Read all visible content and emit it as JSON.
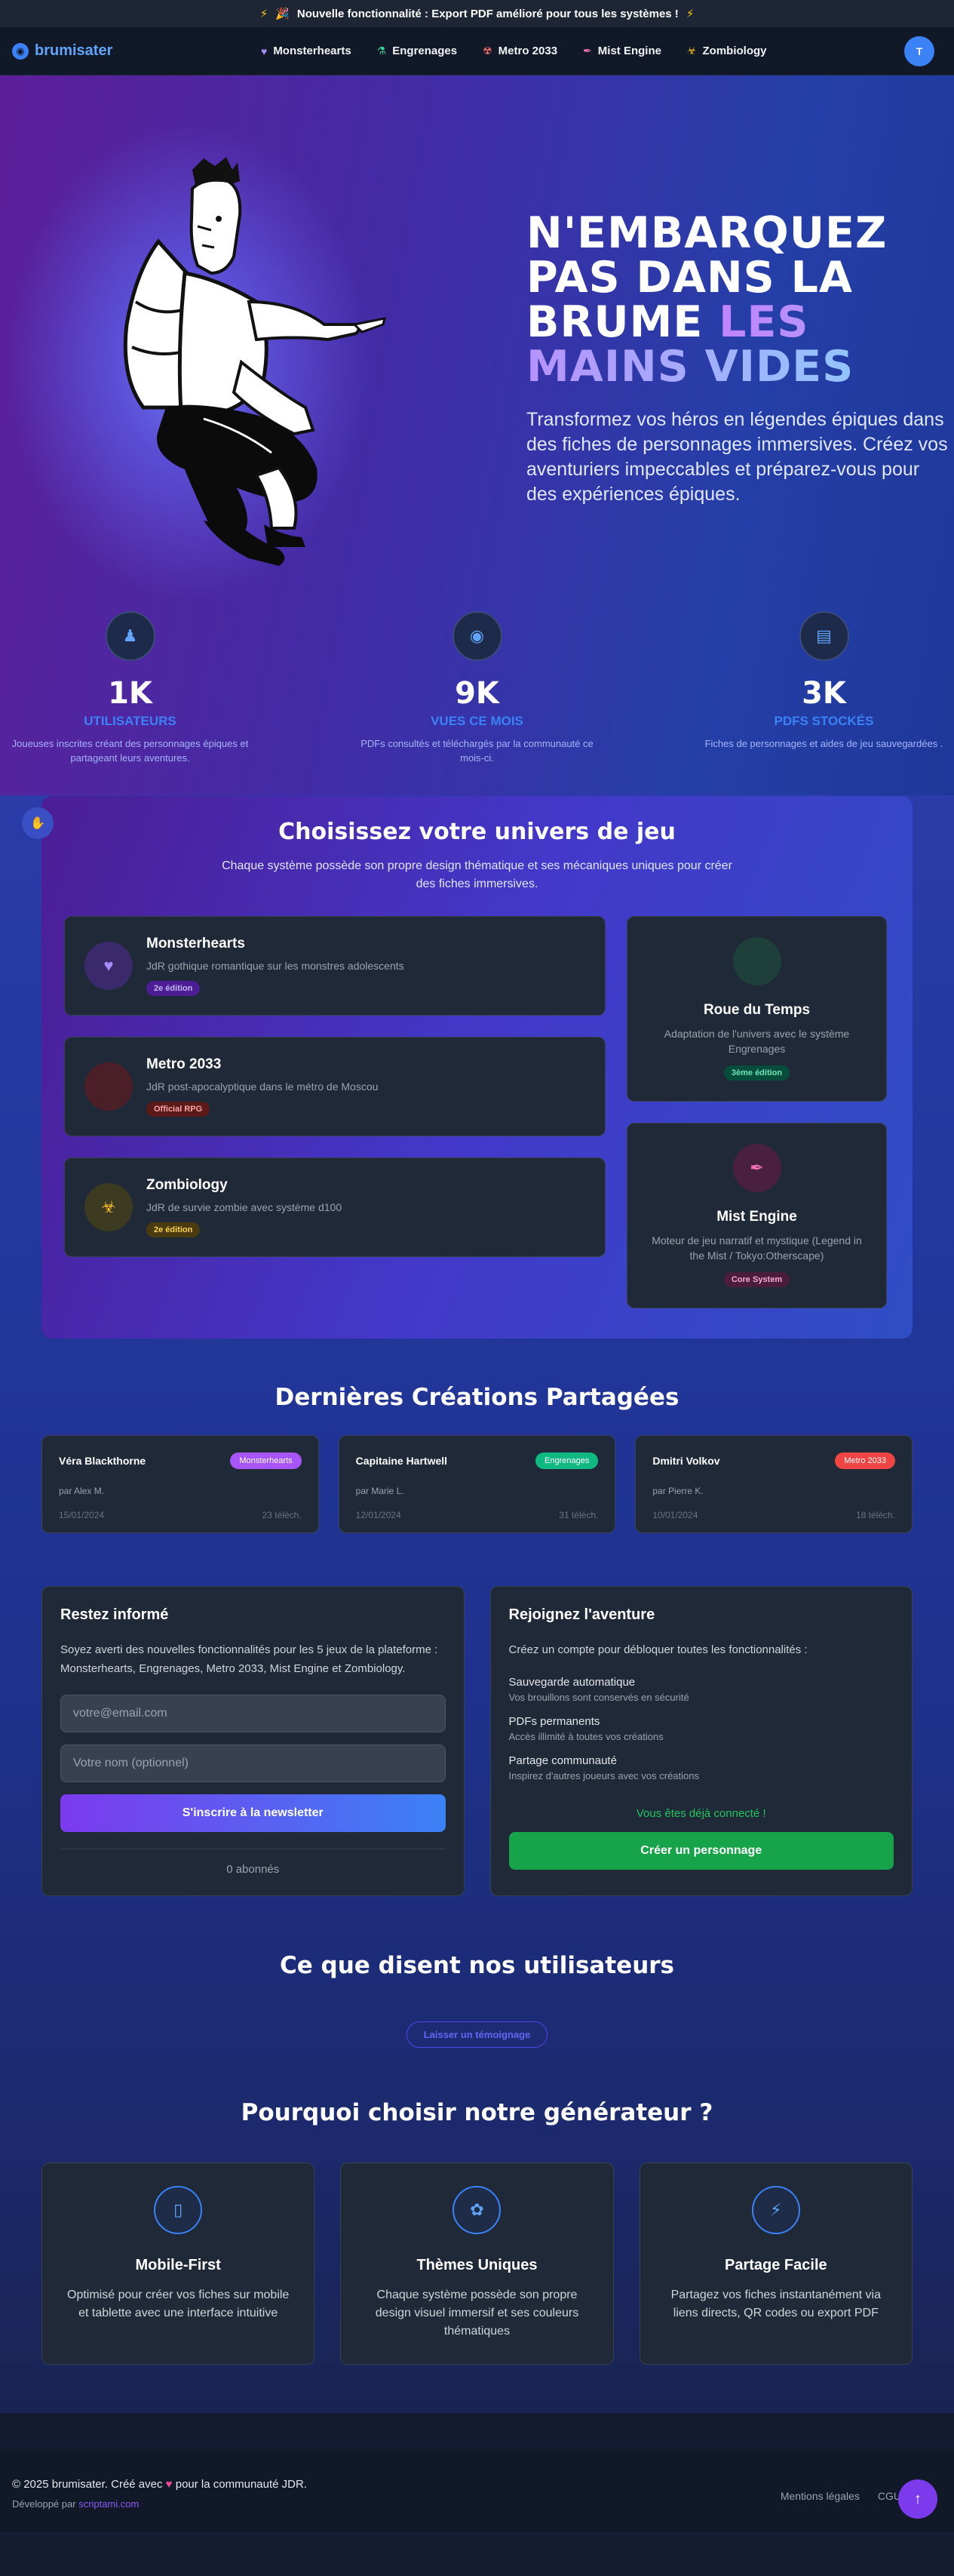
{
  "banner": {
    "text": "Nouvelle fonctionnalité : Export PDF amélioré pour tous les systèmes !",
    "left_icon": "zap-icon",
    "flag_icon": "party-icon"
  },
  "nav": {
    "brand": "brumisater",
    "links": [
      {
        "label": "Monsterhearts",
        "icon": "heart-icon",
        "color": "#a78bfa"
      },
      {
        "label": "Engrenages",
        "icon": "flask-icon",
        "color": "#34d399"
      },
      {
        "label": "Metro 2033",
        "icon": "radiation-icon",
        "color": "#f87171"
      },
      {
        "label": "Mist Engine",
        "icon": "feather-icon",
        "color": "#f472b6"
      },
      {
        "label": "Zombiology",
        "icon": "biohazard-icon",
        "color": "#fbbf24"
      }
    ],
    "avatar": "T"
  },
  "hero": {
    "title_white": "N'EMBARQUEZ PAS DANS LA BRUME",
    "title_accent": "LES MAINS VIDES",
    "subtitle": "Transformez vos héros en légendes épiques dans des fiches de personnages immersives. Créez vos aventuriers impeccables et préparez-vous pour des expériences épiques."
  },
  "stats": [
    {
      "value": "1K",
      "label": "UTILISATEURS",
      "desc": "Joueuses inscrites créant des personnages épiques et partageant leurs aventures.",
      "icon": "user-icon"
    },
    {
      "value": "9K",
      "label": "VUES CE MOIS",
      "desc": "PDFs consultés et téléchargés par la communauté ce mois-ci.",
      "icon": "eye-icon"
    },
    {
      "value": "3K",
      "label": "PDFS STOCKÉS",
      "desc": "Fiches de personnages et aides de jeu sauvegardées .",
      "icon": "file-icon"
    }
  ],
  "universe": {
    "title": "Choisissez votre univers de jeu",
    "subtitle": "Chaque système possède son propre design thématique et ses mécaniques uniques pour créer des fiches immersives.",
    "left": [
      {
        "name": "Monsterhearts",
        "desc": "JdR gothique romantique sur les monstres adolescents",
        "badge": "2e édition",
        "badge_bg": "#4c1d95",
        "badge_fg": "#c4b5fd",
        "icon_bg": "#3b2a6b",
        "icon_color": "#a78bfa",
        "icon": "heart-icon"
      },
      {
        "name": "Metro 2033",
        "desc": "JdR post-apocalyptique dans le métro de Moscou",
        "badge": "Official RPG",
        "badge_bg": "#5b1a1a",
        "badge_fg": "#fca5a5",
        "icon_bg": "#4a1f28",
        "icon_color": "#f87171",
        "icon": "radiation-icon"
      },
      {
        "name": "Zombiology",
        "desc": "JdR de survie zombie avec système d100",
        "badge": "2e édition",
        "badge_bg": "#4a3a10",
        "badge_fg": "#fcd34d",
        "icon_bg": "#3d3a22",
        "icon_color": "#fbbf24",
        "icon": "biohazard-icon"
      }
    ],
    "right": [
      {
        "name": "Roue du Temps",
        "desc": "Adaptation de l'univers avec le système Engrenages",
        "badge": "3ème édition",
        "badge_bg": "#064e3b",
        "badge_fg": "#6ee7b7",
        "icon_bg": "#1f3f3a",
        "icon_color": "#34d399",
        "icon": ""
      },
      {
        "name": "Mist Engine",
        "desc": "Moteur de jeu narratif et mystique (Legend in the Mist / Tokyo:Otherscape)",
        "badge": "Core System",
        "badge_bg": "#4a1d3a",
        "badge_fg": "#f9a8d4",
        "icon_bg": "#4a2040",
        "icon_color": "#f472b6",
        "icon": "feather-icon"
      }
    ]
  },
  "creations": {
    "title": "Dernières Créations Partagées",
    "items": [
      {
        "name": "Véra Blackthorne",
        "system": "Monsterhearts",
        "color": "#a855f7",
        "by": "par Alex M.",
        "date": "15/01/2024",
        "downloads": "23 téléch."
      },
      {
        "name": "Capitaine Hartwell",
        "system": "Engrenages",
        "color": "#10b981",
        "by": "par Marie L.",
        "date": "12/01/2024",
        "downloads": "31 téléch."
      },
      {
        "name": "Dmitri Volkov",
        "system": "Metro 2033",
        "color": "#ef4444",
        "by": "par Pierre K.",
        "date": "10/01/2024",
        "downloads": "18 téléch."
      }
    ]
  },
  "newsletter": {
    "title": "Restez informé",
    "text": "Soyez averti des nouvelles fonctionnalités pour les 5 jeux de la plateforme : Monsterhearts, Engrenages, Metro 2033, Mist Engine et Zombiology.",
    "email_placeholder": "votre@email.com",
    "name_placeholder": "Votre nom (optionnel)",
    "button": "S'inscrire à la newsletter",
    "subscribers": "0 abonnés"
  },
  "join": {
    "title": "Rejoignez l'aventure",
    "text": "Créez un compte pour débloquer toutes les fonctionnalités :",
    "features": [
      {
        "title": "Sauvegarde automatique",
        "desc": "Vos brouillons sont conservés en sécurité"
      },
      {
        "title": "PDFs permanents",
        "desc": "Accès illimité à toutes vos créations"
      },
      {
        "title": "Partage communauté",
        "desc": "Inspirez d'autres joueurs avec vos créations"
      }
    ],
    "connected": "Vous êtes déjà connecté !",
    "button": "Créer un personnage"
  },
  "testimonials": {
    "title": "Ce que disent nos utilisateurs",
    "button": "Laisser un témoignage"
  },
  "why": {
    "title": "Pourquoi choisir notre générateur ?",
    "items": [
      {
        "title": "Mobile-First",
        "desc": "Optimisé pour créer vos fiches sur mobile et tablette avec une interface intuitive",
        "icon": "mobile-icon"
      },
      {
        "title": "Thèmes Uniques",
        "desc": "Chaque système possède son propre design visuel immersif et ses couleurs thématiques",
        "icon": "palette-icon"
      },
      {
        "title": "Partage Facile",
        "desc": "Partagez vos fiches instantanément via liens directs, QR codes ou export PDF",
        "icon": "bolt-icon"
      }
    ]
  },
  "footer": {
    "copy_before": "© 2025 brumisater. Créé avec",
    "copy_after": "pour la communauté JDR.",
    "dev_prefix": "Développé par",
    "dev_name": "scriptami.com",
    "links": [
      "Mentions légales",
      "CGU"
    ]
  }
}
